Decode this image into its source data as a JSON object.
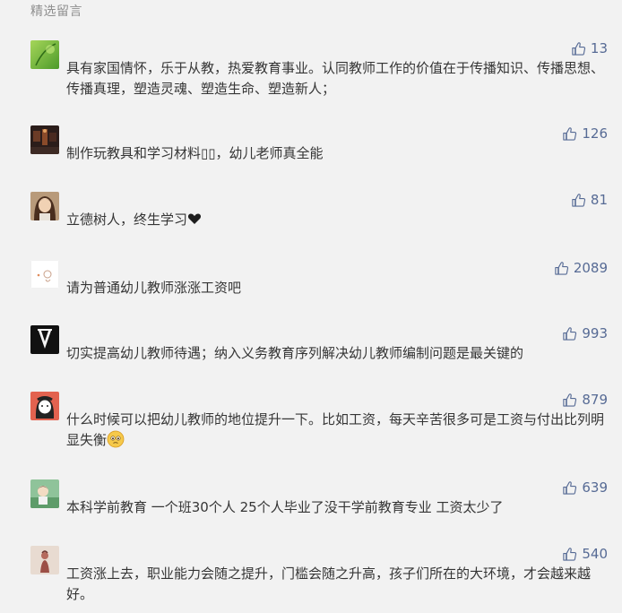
{
  "section": {
    "title": "精选留言"
  },
  "comments": [
    {
      "likes": "13",
      "text": "具有家国情怀，乐于从教，热爱教育事业。认同教师工作的价值在于传播知识、传播思想、传播真理，塑造灵魂、塑造生命、塑造新人；",
      "avatar": "green-leaf-avatar"
    },
    {
      "likes": "126",
      "text": "制作玩教具和学习材料▯▯，幼儿老师真全能",
      "avatar": "dark-room-avatar"
    },
    {
      "likes": "81",
      "text": "立德树人，终生学习",
      "emoji": "heart",
      "avatar": "girl-portrait-avatar"
    },
    {
      "likes": "2089",
      "text": "请为普通幼儿教师涨涨工资吧",
      "avatar": "sketch-avatar"
    },
    {
      "likes": "993",
      "text": "切实提高幼儿教师待遇；纳入义务教育序列解决幼儿教师编制问题是最关键的",
      "avatar": "suit-avatar"
    },
    {
      "likes": "879",
      "text": "什么时候可以把幼儿教师的地位提升一下。比如工资，每天辛苦很多可是工资与付出比列明显失衡",
      "emoji": "face",
      "avatar": "cartoon-girl-avatar"
    },
    {
      "likes": "639",
      "text": "本科学前教育 一个班30个人 25个人毕业了没干学前教育专业 工资太少了",
      "avatar": "cartoon-child-avatar"
    },
    {
      "likes": "540",
      "text": "工资涨上去，职业能力会随之提升，门槛会随之升高，孩子们所在的大环境，才会越来越好。",
      "avatar": "figure-avatar"
    }
  ],
  "colors": {
    "like": "#576b95",
    "text": "#353535",
    "background": "#f2f2f2",
    "title": "#8f8f8f"
  },
  "icons": {
    "like": "thumbs-up-icon",
    "heart": "black-heart-icon",
    "face": "pleading-face-icon"
  }
}
